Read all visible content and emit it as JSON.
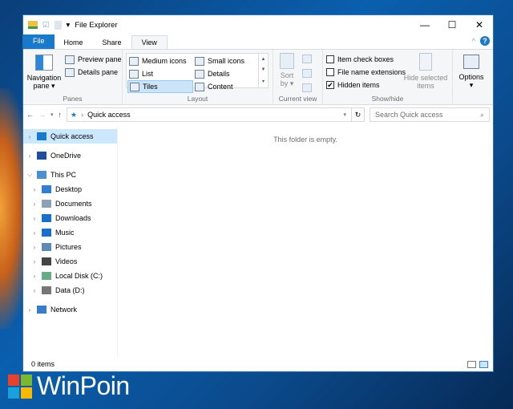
{
  "window": {
    "title": "File Explorer",
    "minimize": "—",
    "maximize": "☐",
    "close": "✕"
  },
  "tabs": [
    "File",
    "Home",
    "Share",
    "View"
  ],
  "help": "?",
  "ribbon": {
    "panes": {
      "navigation_pane": "Navigation pane ▾",
      "preview_pane": "Preview pane",
      "details_pane": "Details pane",
      "label": "Panes"
    },
    "layout": {
      "items": [
        "Medium icons",
        "Small icons",
        "List",
        "Details",
        "Tiles",
        "Content"
      ],
      "selected": "Tiles",
      "label": "Layout"
    },
    "current_view": {
      "sort_by": "Sort by ▾",
      "label": "Current view"
    },
    "show_hide": {
      "item_check_boxes": "Item check boxes",
      "item_check_boxes_checked": false,
      "file_name_extensions": "File name extensions",
      "file_name_extensions_checked": false,
      "hidden_items": "Hidden items",
      "hidden_items_checked": true,
      "hide_selected": "Hide selected items",
      "label": "Show/hide"
    },
    "options": "Options ▾"
  },
  "address": {
    "path": "Quick access",
    "search_placeholder": "Search Quick access"
  },
  "nav": [
    {
      "label": "Quick access",
      "color": "#1979ca",
      "selected": true
    },
    {
      "label": "OneDrive",
      "color": "#1f4f9a"
    },
    {
      "label": "This PC",
      "color": "#4a90d0",
      "expanded": true
    },
    {
      "label": "Desktop",
      "color": "#2f7fd0",
      "child": true
    },
    {
      "label": "Documents",
      "color": "#8ca0b8",
      "child": true
    },
    {
      "label": "Downloads",
      "color": "#1b6fc9",
      "child": true
    },
    {
      "label": "Music",
      "color": "#1b6fc9",
      "child": true
    },
    {
      "label": "Pictures",
      "color": "#5a8ab5",
      "child": true
    },
    {
      "label": "Videos",
      "color": "#444",
      "child": true
    },
    {
      "label": "Local Disk (C:)",
      "color": "#6a8",
      "child": true
    },
    {
      "label": "Data (D:)",
      "color": "#777",
      "child": true
    },
    {
      "label": "Network",
      "color": "#3a7bc8"
    }
  ],
  "content": {
    "empty_message": "This folder is empty."
  },
  "status": {
    "items": "0 items"
  },
  "brand": {
    "logo_text": "WinPoin",
    "colors": [
      "#e8412c",
      "#7cb82f",
      "#1aa0db",
      "#f8b900"
    ]
  }
}
